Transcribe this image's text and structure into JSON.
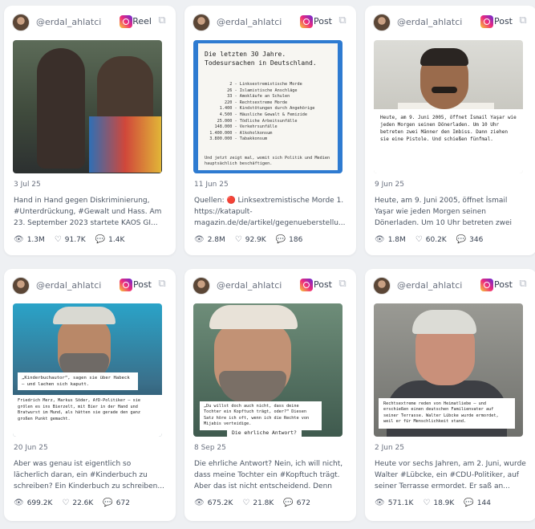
{
  "handle": "@erdal_ahlatci",
  "posts": [
    {
      "type": "Reel",
      "date": "3 Jul 25",
      "caption": "Hand in Hand gegen Diskriminierung, #Unterdrückung, #Gewalt und Hass. Am 23. September 2023 startete KAOS GI...",
      "views": "1.3M",
      "likes": "91.7K",
      "comments": "1.4K"
    },
    {
      "type": "Post",
      "date": "11 Jun 25",
      "caption": "Quellen: 🔴 Linksextremistische Morde 1. https://katapult-magazin.de/de/artikel/gegenueberstellu...",
      "views": "2.8M",
      "likes": "92.9K",
      "comments": "186",
      "image_title": "Die letzten 30 Jahre.\nTodesursachen in Deutschland.",
      "image_list": "          2 - Linksextremistische Morde\n         26 - Islamistische Anschläge\n         33 - Amokläufe an Schulen\n        220 - Rechtsextreme Morde\n      1.400 - Kindstötungen durch Angehörige\n      4.500 - Häusliche Gewalt & Femizide\n     25.000 - Tödliche Arbeitsunfälle\n    148.000 - Verkehrsunfälle\n  1.400.000 - Alkoholkonsum\n  3.800.000 - Tabakkonsum",
      "image_footer": "Und jetzt zeigt mal, womit sich Politik und Medien hauptsächlich beschäftigen."
    },
    {
      "type": "Post",
      "date": "9 Jun 25",
      "caption": "Heute, am 9. Juni 2005, öffnet İsmail Yaşar wie jeden Morgen seinen Dönerladen. Um 10 Uhr betreten zwei Männer den Imbiss...",
      "views": "1.8M",
      "likes": "60.2K",
      "comments": "346",
      "image_text": "Heute, am 9. Juni 2005, öffnet İsmail Yaşar wie jeden Morgen seinen Dönerladen. Um 10 Uhr betreten zwei Männer den Imbiss. Dann ziehen sie eine Pistole. Und schießen fünfmal."
    },
    {
      "type": "Post",
      "date": "20 Jun 25",
      "caption": "Aber was genau ist eigentlich so lächerlich daran, ein #Kinderbuch zu schreiben? Ein Kinderbuch zu schreiben...",
      "views": "699.2K",
      "likes": "22.6K",
      "comments": "672",
      "image_quote": "„Kinderbuchautor“, sagen sie über Habeck – und lachen sich kaputt.",
      "image_text": "Friedrich Merz, Markus Söder, AfD-Politiker – sie grölen es ins Bierzelt, mit Bier in der Hand und Bratwurst im Mund, als hätten sie gerade den ganz großen Punkt gemacht."
    },
    {
      "type": "Post",
      "date": "8 Sep 25",
      "caption": "Die ehrliche Antwort? Nein, ich will nicht, dass meine Tochter ein #Kopftuch trägt. Aber das ist nicht entscheidend. Denn es...",
      "views": "675.2K",
      "likes": "21.8K",
      "comments": "672",
      "image_quote": "„Du willst doch auch nicht, dass deine Tochter ein Kopftuch trägt, oder?“ Diesen Satz höre ich oft, wenn ich die Rechte von Mijabis verteidige.",
      "image_answer": "Die ehrliche Antwort?"
    },
    {
      "type": "Post",
      "date": "2 Jun 25",
      "caption": "Heute vor sechs Jahren, am 2. Juni, wurde Walter #Lübcke, ein #CDU-Politiker, auf seiner Terrasse ermordet. Er saß an...",
      "views": "571.1K",
      "likes": "18.9K",
      "comments": "144",
      "image_text": "Rechtsextreme reden von Heimatliebe – und erschießen einen deutschen Familienvater auf seiner Terrasse. Walter Lübcke wurde ermordet, weil er für Menschlichkeit stand."
    }
  ]
}
